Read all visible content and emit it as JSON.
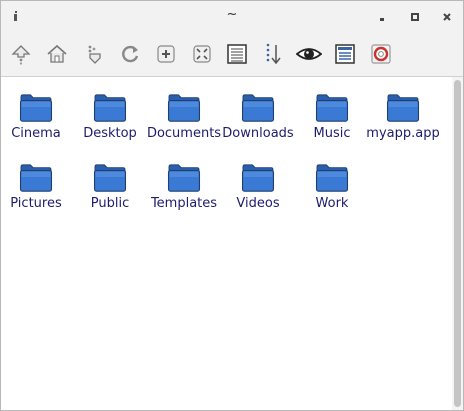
{
  "window": {
    "title": "~"
  },
  "toolbar": {
    "buttons": [
      {
        "name": "up-button",
        "icon": "up-icon"
      },
      {
        "name": "home-button",
        "icon": "home-icon"
      },
      {
        "name": "goto-button",
        "icon": "go-icon"
      },
      {
        "name": "reload-button",
        "icon": "reload-icon"
      },
      {
        "name": "zoom-in-button",
        "icon": "zoom-in-icon"
      },
      {
        "name": "zoom-fit-button",
        "icon": "zoom-fit-icon"
      },
      {
        "name": "view-list-button",
        "icon": "list-icon"
      },
      {
        "name": "sort-button",
        "icon": "sort-icon"
      },
      {
        "name": "show-hidden-button",
        "icon": "eye-icon"
      },
      {
        "name": "details-view-button",
        "icon": "details-icon"
      },
      {
        "name": "help-button",
        "icon": "lifebuoy-icon"
      }
    ]
  },
  "folders": [
    {
      "label": "Cinema"
    },
    {
      "label": "Desktop"
    },
    {
      "label": "Documents"
    },
    {
      "label": "Downloads"
    },
    {
      "label": "Music"
    },
    {
      "label": "myapp.app"
    },
    {
      "label": "Pictures"
    },
    {
      "label": "Public"
    },
    {
      "label": "Templates"
    },
    {
      "label": "Videos"
    },
    {
      "label": "Work"
    }
  ],
  "colors": {
    "folder_blue": "#2f6fc8",
    "label_text": "#1c1c6e"
  }
}
